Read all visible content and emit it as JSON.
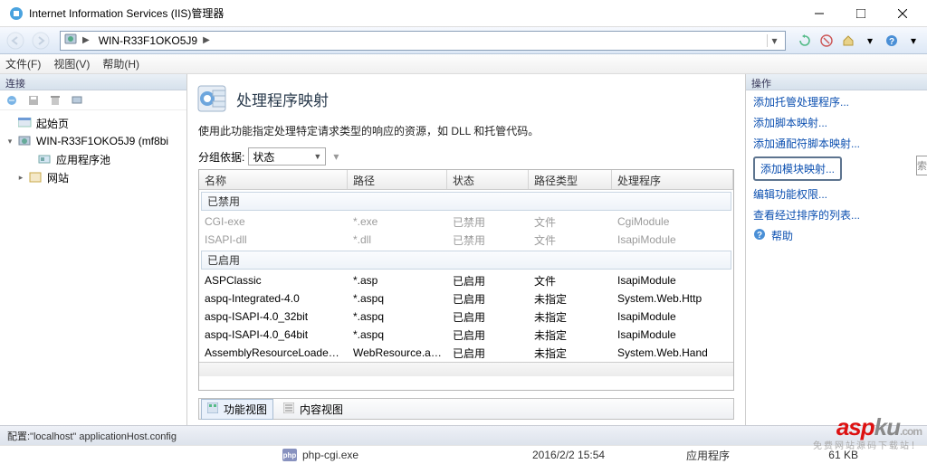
{
  "window": {
    "title": "Internet Information Services (IIS)管理器"
  },
  "breadcrumb": {
    "host": "WIN-R33F1OKO5J9"
  },
  "menubar": {
    "file": "文件(F)",
    "view": "视图(V)",
    "help": "帮助(H)"
  },
  "leftpane": {
    "header": "连接",
    "tree": {
      "start": "起始页",
      "server": "WIN-R33F1OKO5J9 (mf8bi",
      "apppools": "应用程序池",
      "sites": "网站"
    }
  },
  "center": {
    "title": "处理程序映射",
    "desc": "使用此功能指定处理特定请求类型的响应的资源，如 DLL 和托管代码。",
    "groupby_label": "分组依据:",
    "groupby_value": "状态",
    "columns": [
      "名称",
      "路径",
      "状态",
      "路径类型",
      "处理程序"
    ],
    "group_disabled": "已禁用",
    "group_enabled": "已启用",
    "rows_disabled": [
      {
        "name": "CGI-exe",
        "path": "*.exe",
        "state": "已禁用",
        "ptype": "文件",
        "handler": "CgiModule"
      },
      {
        "name": "ISAPI-dll",
        "path": "*.dll",
        "state": "已禁用",
        "ptype": "文件",
        "handler": "IsapiModule"
      }
    ],
    "rows_enabled": [
      {
        "name": "ASPClassic",
        "path": "*.asp",
        "state": "已启用",
        "ptype": "文件",
        "handler": "IsapiModule"
      },
      {
        "name": "aspq-Integrated-4.0",
        "path": "*.aspq",
        "state": "已启用",
        "ptype": "未指定",
        "handler": "System.Web.Http"
      },
      {
        "name": "aspq-ISAPI-4.0_32bit",
        "path": "*.aspq",
        "state": "已启用",
        "ptype": "未指定",
        "handler": "IsapiModule"
      },
      {
        "name": "aspq-ISAPI-4.0_64bit",
        "path": "*.aspq",
        "state": "已启用",
        "ptype": "未指定",
        "handler": "IsapiModule"
      },
      {
        "name": "AssemblyResourceLoader-I...",
        "path": "WebResource.axd",
        "state": "已启用",
        "ptype": "未指定",
        "handler": "System.Web.Hand"
      }
    ],
    "view_feature": "功能视图",
    "view_content": "内容视图"
  },
  "actions": {
    "header": "操作",
    "add_managed": "添加托管处理程序...",
    "add_script": "添加脚本映射...",
    "add_wildcard": "添加通配符脚本映射...",
    "add_module": "添加模块映射...",
    "edit_perm": "编辑功能权限...",
    "view_sorted": "查看经过排序的列表...",
    "help": "帮助"
  },
  "search_clip": "索\"P",
  "statusbar": {
    "text": "配置:\"localhost\" applicationHost.config"
  },
  "explorer": {
    "name": "php-cgi.exe",
    "date": "2016/2/2 15:54",
    "type": "应用程序",
    "size": "61 KB",
    "icon_text": "php"
  },
  "watermark": {
    "main": "aspku",
    "sub": "免费网站源码下载站！"
  }
}
